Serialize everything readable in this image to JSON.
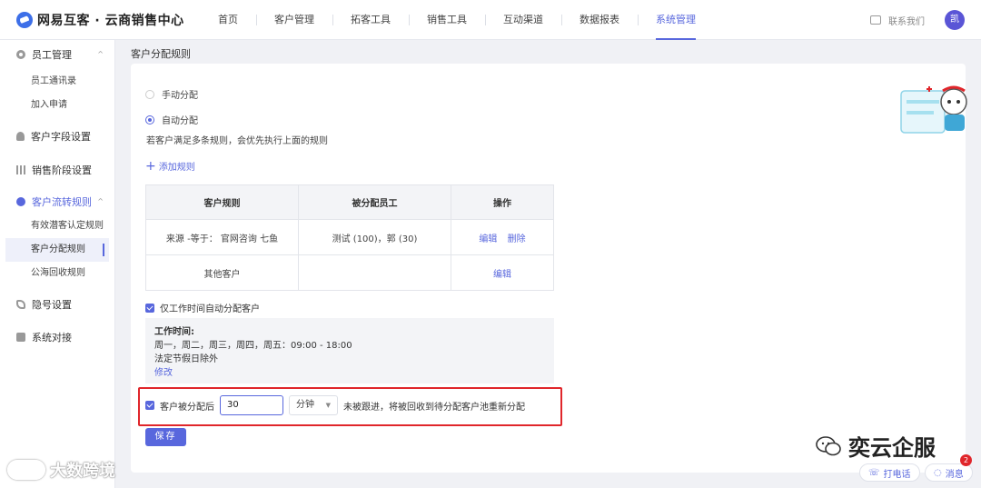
{
  "header": {
    "logo_text": "网易互客 · 云商销售中心",
    "nav": [
      "首页",
      "客户管理",
      "拓客工具",
      "销售工具",
      "互动渠道",
      "数据报表",
      "系统管理"
    ],
    "active_nav": "系统管理",
    "contact_label": "联系我们",
    "avatar_text": "凯"
  },
  "sidebar": {
    "groups": [
      {
        "label": "员工管理",
        "icon": "gear-icon",
        "chevron": "^",
        "children": [
          "员工通讯录",
          "加入申请"
        ]
      },
      {
        "label": "客户字段设置",
        "icon": "user-icon"
      },
      {
        "label": "销售阶段设置",
        "icon": "bar-chart-icon"
      },
      {
        "label": "客户流转规则",
        "icon": "flow-icon",
        "chevron": "^",
        "children": [
          "有效潜客认定规则",
          "客户分配规则",
          "公海回收规则"
        ]
      },
      {
        "label": "隐号设置",
        "icon": "phone-icon"
      },
      {
        "label": "系统对接",
        "icon": "system-icon"
      }
    ],
    "active_item": "客户分配规则"
  },
  "page": {
    "title": "客户分配规则",
    "radio_manual": "手动分配",
    "radio_auto": "自动分配",
    "selected_mode": "自动分配",
    "note": "若客户满足多条规则，会优先执行上面的规则",
    "add_rule": "添加规则",
    "table": {
      "headers": [
        "客户规则",
        "被分配员工",
        "操作"
      ],
      "rows": [
        {
          "rule": "来源 -等于：  官网咨询    七鱼",
          "staff": "测试 (100)，郭 (30)",
          "actions": [
            "编辑",
            "删除"
          ]
        },
        {
          "rule": "其他客户",
          "staff": "",
          "actions": [
            "编辑"
          ]
        }
      ]
    },
    "worktime_check_label": "仅工作时间自动分配客户",
    "worktime": {
      "title": "工作时间:",
      "days": "周一，周二，周三，周四，周五：09:00 - 18:00",
      "holiday": "法定节假日除外",
      "edit": "修改"
    },
    "recycle": {
      "label_before": "客户被分配后",
      "value": "30",
      "unit": "分钟",
      "label_after": "未被跟进，将被回收到待分配客户池重新分配"
    },
    "save": "保存"
  },
  "watermarks": {
    "left": "大数跨境",
    "right": "奕云企服"
  },
  "float_buttons": {
    "call": "打电话",
    "message": "消息",
    "message_badge": "2"
  },
  "colors": {
    "accent": "#5867dd",
    "highlight_border": "#e0262b"
  }
}
